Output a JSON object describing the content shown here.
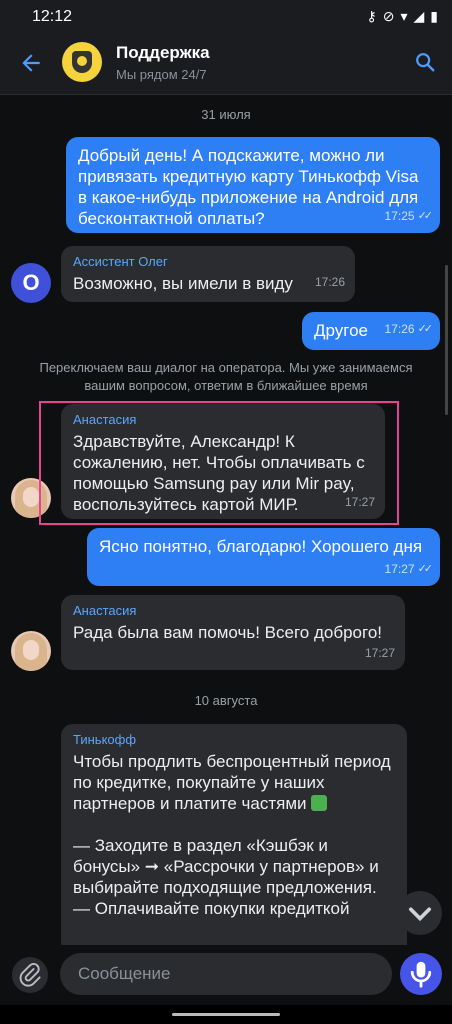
{
  "status_bar": {
    "time": "12:12"
  },
  "header": {
    "title": "Поддержка",
    "subtitle": "Мы рядом 24/7"
  },
  "chat": {
    "date1": "31 июля",
    "m1": {
      "text": "Добрый день! А подскажите, можно ли привязать кредитную карту Тинькофф Visa в какое-нибудь приложение на Android для бесконтактной оплаты?",
      "time": "17:25"
    },
    "m2": {
      "sender": "Ассистент Олег",
      "avatar_letter": "О",
      "text": "Возможно, вы имели в виду",
      "time": "17:26"
    },
    "m3": {
      "text": "Другое",
      "time": "17:26"
    },
    "system": "Переключаем ваш диалог на оператора. Мы уже занимаемся вашим вопросом, ответим в ближайшее время",
    "m4": {
      "sender": "Анастасия",
      "text": "Здравствуйте, Александр! К сожалению, нет. Чтобы оплачивать с помощью Samsung pay или Mir pay, воспользуйтесь картой МИР.",
      "time": "17:27"
    },
    "m5": {
      "text": "Ясно понятно, благодарю! Хорошего дня",
      "time": "17:27"
    },
    "m6": {
      "sender": "Анастасия",
      "text": "Рада была вам помочь! Всего доброго!",
      "time": "17:27"
    },
    "date2": "10 августа",
    "m7": {
      "sender": "Тинькофф",
      "text1": "Чтобы продлить беспроцентный период по кредитке, покупайте у наших партнеров и платите частями",
      "text2": "— Заходите в раздел «Кэшбэк и бонусы» ➞ «Рассрочки у партнеров» и выбирайте подходящие предложения.",
      "text3": "— Оплачивайте покупки кредиткой"
    }
  },
  "composer": {
    "placeholder": "Сообщение"
  },
  "colors": {
    "outgoing": "#2f7ff4",
    "incoming": "#2b2c30",
    "accent": "#5aa6ff",
    "highlight": "#e84393"
  }
}
